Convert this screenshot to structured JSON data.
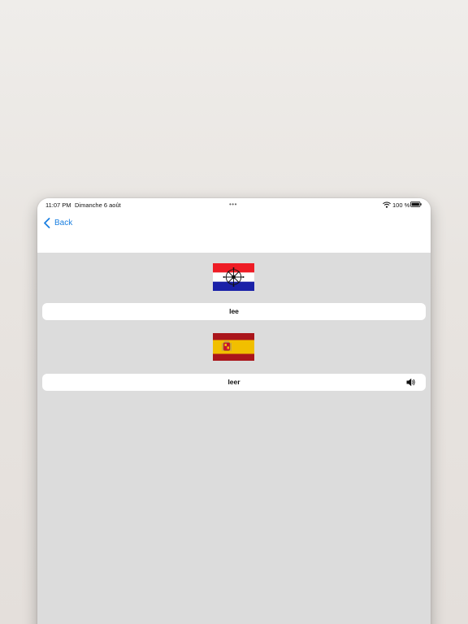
{
  "status_bar": {
    "time": "11:07 PM",
    "date": "Dimanche 6 août",
    "dots": "•••",
    "battery_percent": "100 %"
  },
  "nav": {
    "back_label": "Back"
  },
  "source_language": {
    "flag_icon": "flag-icon-red-white-blue-with-emblem",
    "word": "lee"
  },
  "target_language": {
    "flag_icon": "spain-flag-icon",
    "word": "leer",
    "speaker_icon": "speaker-icon"
  },
  "colors": {
    "accent": "#1a7fe0",
    "content_bg": "#dcdcdc",
    "card_bg": "#ffffff"
  }
}
